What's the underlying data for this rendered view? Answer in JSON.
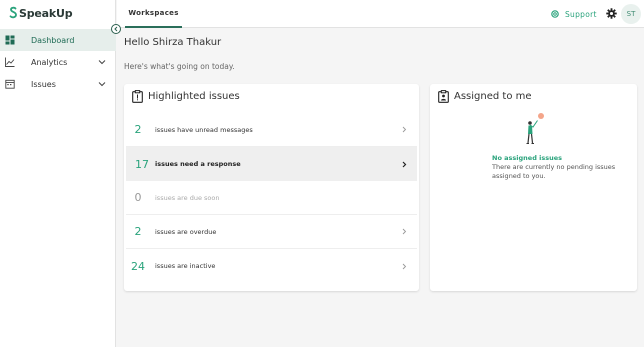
{
  "app": {
    "name": "SpeakUp"
  },
  "sidebar": {
    "items": [
      {
        "label": "Dashboard",
        "icon": "dashboard-icon",
        "active": true
      },
      {
        "label": "Analytics",
        "icon": "chart-line-icon",
        "expandable": true
      },
      {
        "label": "Issues",
        "icon": "calendar-icon",
        "expandable": true
      }
    ]
  },
  "topbar": {
    "tab_label": "Workspaces",
    "support_label": "Support",
    "avatar_initials": "ST"
  },
  "main": {
    "greeting": "Hello Shirza Thakur",
    "subgreeting": "Here's what's going on today."
  },
  "highlighted": {
    "title": "Highlighted issues",
    "rows": [
      {
        "count": "2",
        "text": "issues have unread messages"
      },
      {
        "count": "17",
        "text": "issues need a response"
      },
      {
        "count": "0",
        "text": "issues are due soon"
      },
      {
        "count": "2",
        "text": "issues are overdue"
      },
      {
        "count": "24",
        "text": "issues are inactive"
      }
    ]
  },
  "assigned": {
    "title": "Assigned to me",
    "empty_title": "No assigned issues",
    "empty_text": "There are currently no pending issues assigned to you."
  },
  "colors": {
    "accent": "#2aa37c",
    "brand_dark": "#2b5f4e",
    "active_bg": "#e6eeeb"
  }
}
